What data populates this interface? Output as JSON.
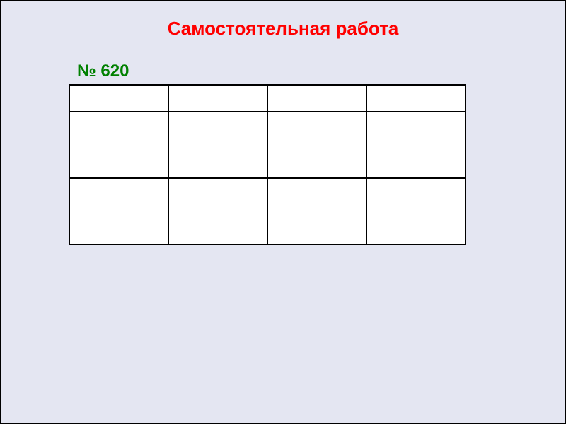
{
  "title": "Самостоятельная работа",
  "subtitle": "№ 620",
  "table": {
    "columns": 4,
    "header_row": [
      "",
      "",
      "",
      ""
    ],
    "body_rows": [
      [
        "",
        "",
        "",
        ""
      ],
      [
        "",
        "",
        "",
        ""
      ]
    ]
  }
}
